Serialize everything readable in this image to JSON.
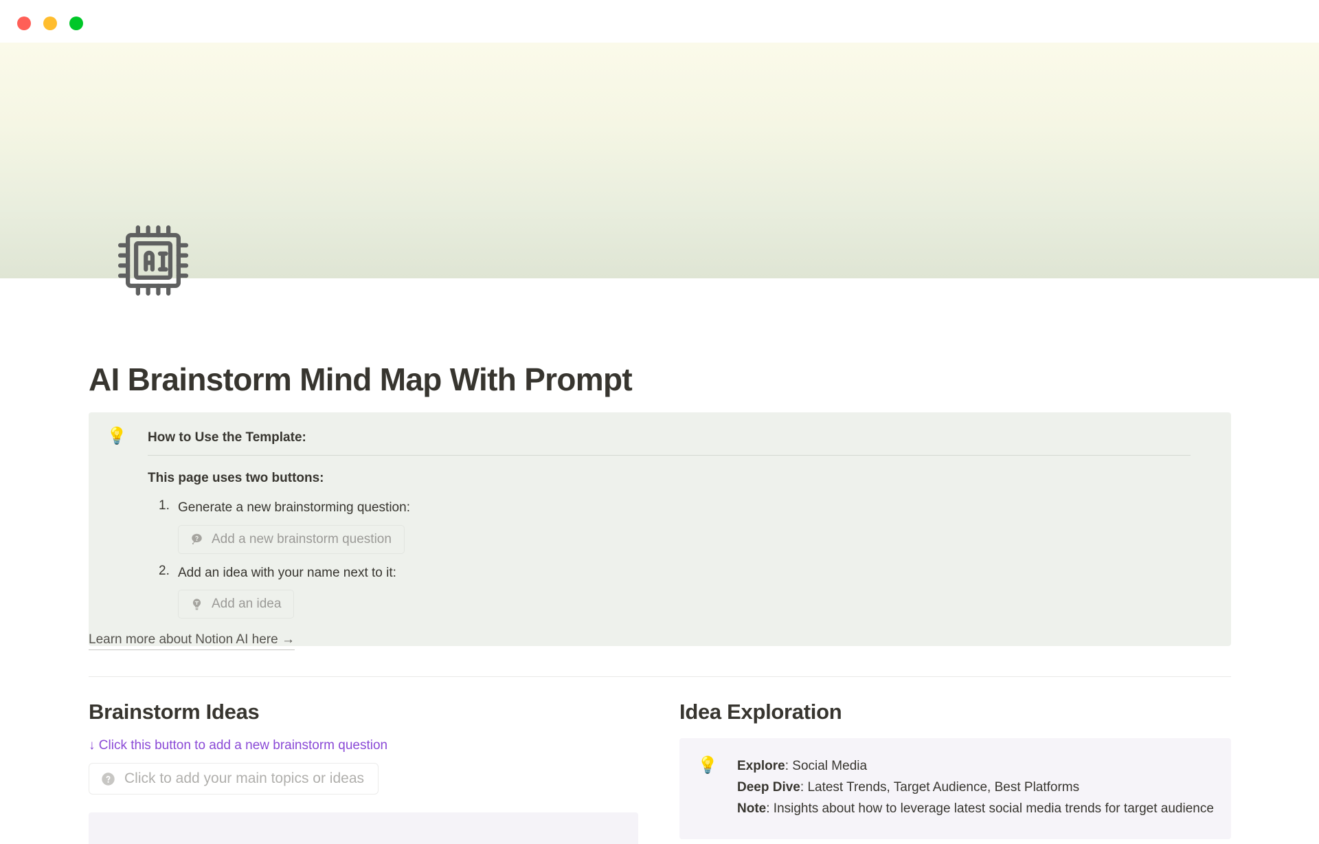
{
  "window": {
    "traffic_lights": [
      {
        "name": "close",
        "color": "#ff5f57"
      },
      {
        "name": "minimize",
        "color": "#ffbd2e"
      },
      {
        "name": "maximize",
        "color": "#00c728"
      }
    ]
  },
  "cover": {
    "gradient_from": "#fbfaea",
    "gradient_to": "#dfe5d4"
  },
  "page": {
    "icon": "ai-chip-icon",
    "title": "AI Brainstorm Mind Map With Prompt"
  },
  "callout": {
    "icon": "lightbulb-emoji",
    "emoji": "💡",
    "background": "#eef1ec",
    "heading": "How to Use the Template:",
    "subheading": "This page uses two buttons:",
    "steps": [
      {
        "text": "Generate a new brainstorming question:",
        "button": {
          "icon": "question-bubble-icon",
          "label": "Add a new brainstorm question"
        }
      },
      {
        "text": "Add an idea with your name next to it:",
        "button": {
          "icon": "lightbulb-icon",
          "label": "Add an idea"
        }
      }
    ]
  },
  "learn_more": {
    "label": "Learn more about Notion AI here →"
  },
  "columns": {
    "left": {
      "title": "Brainstorm Ideas",
      "hint": "↓ Click this button to add a new brainstorm question",
      "hint_color": "#8a49d6",
      "topic_button": {
        "icon": "question-circle-icon",
        "label": "Click to add your main topics or ideas"
      },
      "placeholder_bar_color": "#f5f3f8"
    },
    "right": {
      "title": "Idea Exploration",
      "callout": {
        "icon": "lightbulb-emoji",
        "emoji": "💡",
        "background": "#f6f4f9",
        "lines": [
          {
            "label": "Explore",
            "value": "Social Media"
          },
          {
            "label": "Deep Dive",
            "value": "Latest Trends, Target Audience, Best Platforms"
          },
          {
            "label": "Note",
            "value": "Insights about how to leverage latest social media trends for target audience"
          }
        ]
      }
    }
  }
}
